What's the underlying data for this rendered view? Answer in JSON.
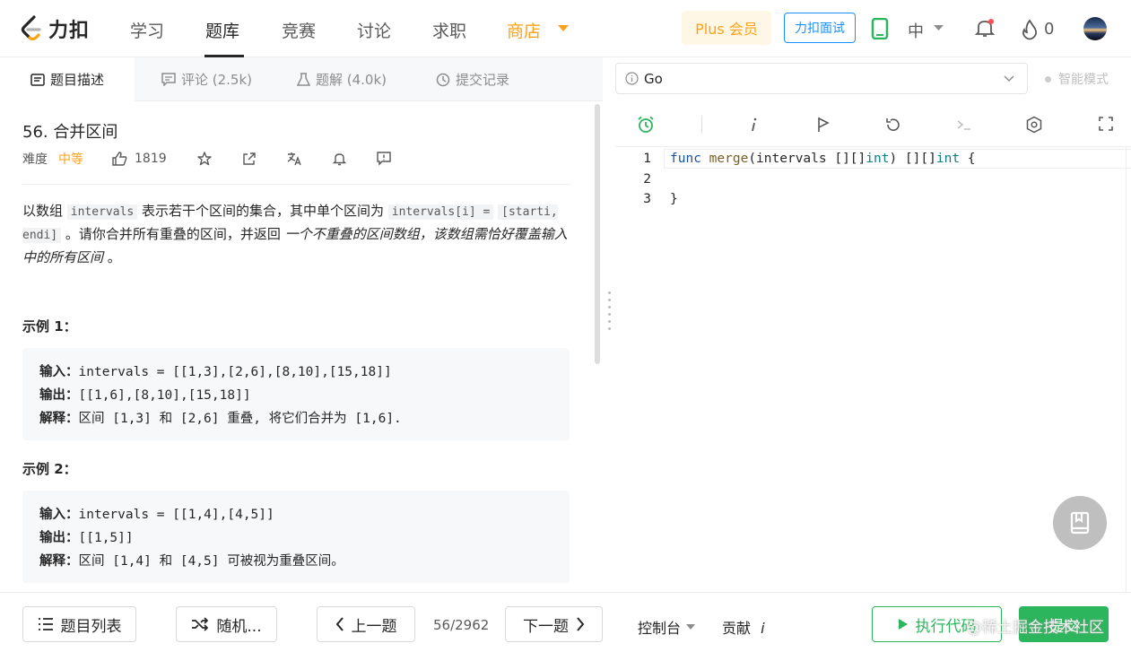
{
  "nav": {
    "logo_text": "力扣",
    "items": [
      "学习",
      "题库",
      "竞赛",
      "讨论",
      "求职"
    ],
    "shop": "商店",
    "plus": "Plus 会员",
    "interview": "力扣面试",
    "lang": "中",
    "points": "0"
  },
  "tabs": [
    "题目描述",
    "评论 (2.5k)",
    "题解 (4.0k)",
    "提交记录"
  ],
  "problem": {
    "title": "56. 合并区间",
    "difficulty_label": "难度",
    "difficulty": "中等",
    "likes": "1819",
    "desc_1": "以数组 ",
    "desc_code1": "intervals",
    "desc_2": " 表示若干个区间的集合，其中单个区间为 ",
    "desc_code2": "intervals[i] =",
    "desc_code3": "[starti, endi]",
    "desc_3": " 。请你合并所有重叠的区间，并返回 ",
    "desc_4": "一个不重叠的区间数组，该数组需恰好覆盖输入中的所有区间",
    "desc_5": " 。"
  },
  "examples": [
    {
      "title": "示例 1：",
      "input_label": "输入：",
      "input": "intervals = [[1,3],[2,6],[8,10],[15,18]]",
      "output_label": "输出：",
      "output": "[[1,6],[8,10],[15,18]]",
      "explain_label": "解释：",
      "explain": "区间 [1,3] 和 [2,6] 重叠, 将它们合并为 [1,6]."
    },
    {
      "title": "示例 2：",
      "input_label": "输入：",
      "input": "intervals = [[1,4],[4,5]]",
      "output_label": "输出：",
      "output": "[[1,5]]",
      "explain_label": "解释：",
      "explain": "区间 [1,4] 和 [4,5] 可被视为重叠区间。"
    }
  ],
  "editor": {
    "language": "Go",
    "smart_mode": "智能模式",
    "line_numbers": [
      "1",
      "2",
      "3"
    ],
    "code_kw": "func",
    "code_fn": "merge",
    "code_mid": "(intervals [][]",
    "code_ty1": "int",
    "code_mid2": ") [][]",
    "code_ty2": "int",
    "code_end": " {",
    "code_line3": "}"
  },
  "bottom": {
    "list": "题目列表",
    "random": "随机...",
    "prev": "上一题",
    "pager": "56/2962",
    "next": "下一题",
    "console": "控制台",
    "contribute": "贡献",
    "contribute_i": "i",
    "run": "执行代码",
    "submit": "提交",
    "watermark": "@稀土掘金技术社区"
  },
  "colors": {
    "accent_orange": "#ffa116",
    "accent_green": "#2db55d",
    "accent_blue": "#1a90ff"
  }
}
